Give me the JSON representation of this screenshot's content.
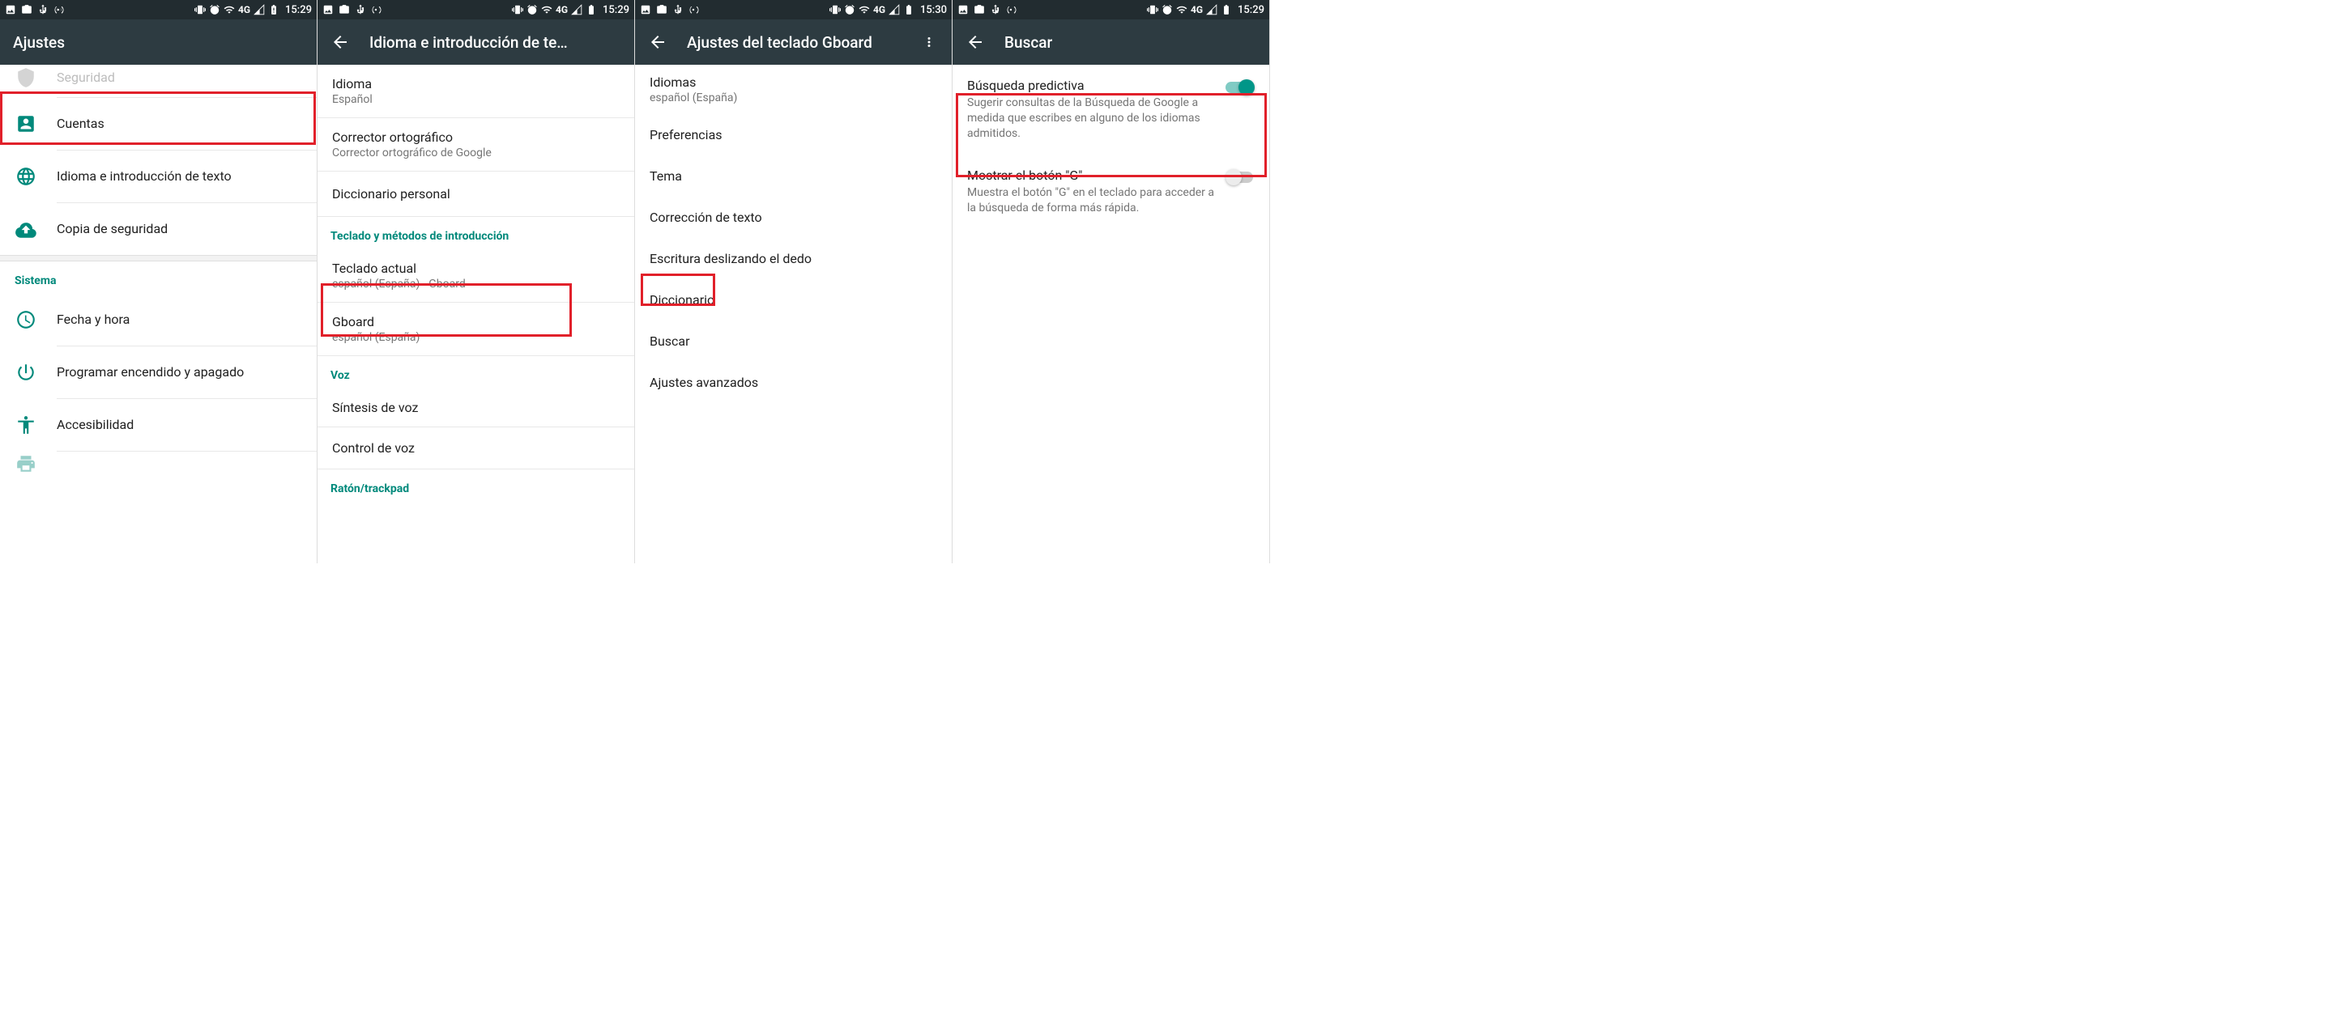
{
  "status": {
    "time_a": "15:29",
    "time_b": "15:30",
    "net": "4G"
  },
  "screen1": {
    "title": "Ajustes",
    "items": {
      "seguridad": "Seguridad",
      "cuentas": "Cuentas",
      "idioma": "Idioma e introducción de texto",
      "copia": "Copia de seguridad"
    },
    "section": "Sistema",
    "sys": {
      "fecha": "Fecha y hora",
      "programar": "Programar encendido y apagado",
      "acces": "Accesibilidad"
    }
  },
  "screen2": {
    "title": "Idioma e introducción de te…",
    "idioma": {
      "t": "Idioma",
      "s": "Español"
    },
    "corrector": {
      "t": "Corrector ortográfico",
      "s": "Corrector ortográfico de Google"
    },
    "diccionario": {
      "t": "Diccionario personal"
    },
    "sec1": "Teclado y métodos de introducción",
    "teclado_actual": {
      "t": "Teclado actual",
      "s": "español (España) - Gboard"
    },
    "gboard": {
      "t": "Gboard",
      "s": "español (España)"
    },
    "sec2": "Voz",
    "sintesis": {
      "t": "Síntesis de voz"
    },
    "control": {
      "t": "Control de voz"
    },
    "sec3": "Ratón/trackpad"
  },
  "screen3": {
    "title": "Ajustes del teclado Gboard",
    "idiomas": {
      "t": "Idiomas",
      "s": "español (España)"
    },
    "items": {
      "preferencias": "Preferencias",
      "tema": "Tema",
      "correcion": "Corrección de texto",
      "escritura": "Escritura deslizando el dedo",
      "diccionario": "Diccionario",
      "buscar": "Buscar",
      "avanzados": "Ajustes avanzados"
    }
  },
  "screen4": {
    "title": "Buscar",
    "predictiva": {
      "t": "Búsqueda predictiva",
      "s": "Sugerir consultas de la Búsqueda de Google a medida que escribes en alguno de los idiomas admitidos."
    },
    "mostrar": {
      "t": "Mostrar el botón \"G\"",
      "s": "Muestra el botón \"G\" en el teclado para acceder a la búsqueda de forma más rápida."
    }
  }
}
